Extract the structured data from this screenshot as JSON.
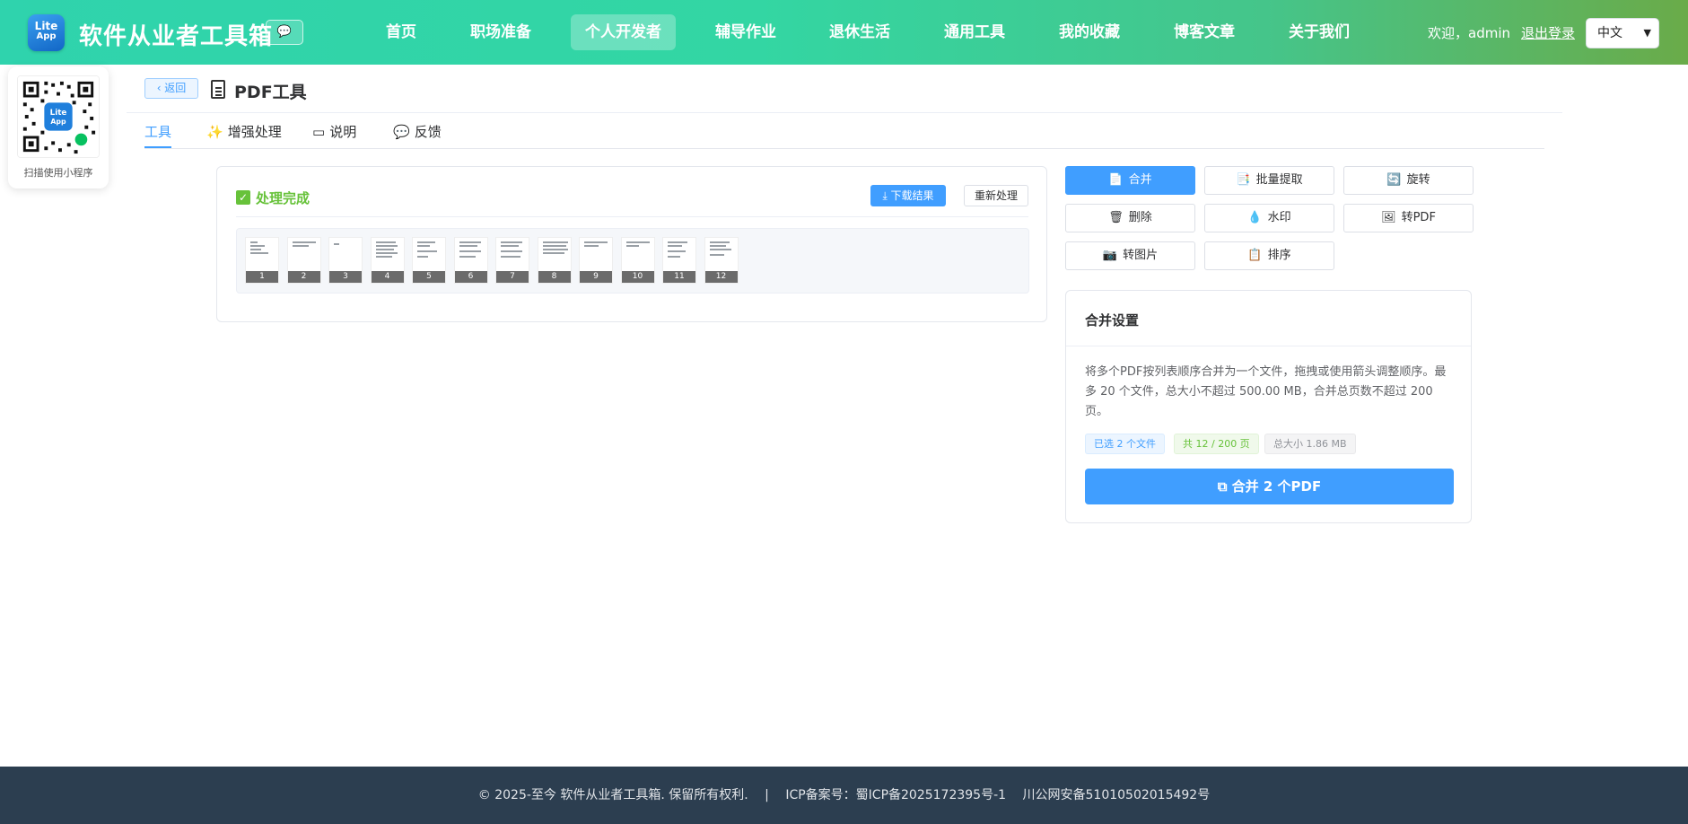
{
  "header": {
    "logo_top": "Lite",
    "logo_bottom": "App",
    "site_title": "软件从业者工具箱",
    "chat_icon": "💬",
    "nav": [
      "首页",
      "职场准备",
      "个人开发者",
      "辅导作业",
      "退休生活",
      "通用工具",
      "我的收藏",
      "博客文章",
      "关于我们"
    ],
    "active_nav": "个人开发者",
    "welcome": "欢迎，admin",
    "logout": "退出登录",
    "language": "中文"
  },
  "qr": {
    "caption": "扫描使用小程序"
  },
  "page": {
    "back_label": "‹ 返回",
    "title": "PDF工具",
    "tabs": [
      {
        "label": "工具",
        "icon": ""
      },
      {
        "label": "增强处理",
        "icon": "✨"
      },
      {
        "label": "说明",
        "icon": "▭"
      },
      {
        "label": "反馈",
        "icon": "💬"
      }
    ]
  },
  "result": {
    "status": "处理完成",
    "download_label": "⤓ 下载结果",
    "redo_label": "重新处理",
    "pages": [
      "1",
      "2",
      "3",
      "4",
      "5",
      "6",
      "7",
      "8",
      "9",
      "10",
      "11",
      "12"
    ]
  },
  "tools": [
    {
      "label": "合并",
      "icon": "📄",
      "active": true
    },
    {
      "label": "批量提取",
      "icon": "📑",
      "active": false
    },
    {
      "label": "旋转",
      "icon": "🔄",
      "active": false
    },
    {
      "label": "删除",
      "icon": "🗑",
      "active": false
    },
    {
      "label": "水印",
      "icon": "💧",
      "active": false
    },
    {
      "label": "转PDF",
      "icon": "🖼",
      "active": false
    },
    {
      "label": "转图片",
      "icon": "📷",
      "active": false
    },
    {
      "label": "排序",
      "icon": "📋",
      "active": false
    }
  ],
  "settings": {
    "title": "合并设置",
    "description": "将多个PDF按列表顺序合并为一个文件，拖拽或使用箭头调整顺序。最多 20 个文件，总大小不超过 500.00 MB，合并总页数不超过 200 页。",
    "tag_selected": "已选 2 个文件",
    "tag_pages": "共 12 / 200 页",
    "tag_size": "总大小 1.86 MB",
    "merge_button": "合并 2 个PDF"
  },
  "footer": {
    "copyright": "© 2025-至今 软件从业者工具箱. 保留所有权利.",
    "separator": "|",
    "icp": "ICP备案号：蜀ICP备2025172395号-1",
    "police": "川公网安备51010502015492号"
  },
  "colors": {
    "primary": "#409eff",
    "success": "#67c23a",
    "footer_bg": "#2c3e50",
    "header_start": "#2fd3ad",
    "header_end": "#6aab49"
  }
}
